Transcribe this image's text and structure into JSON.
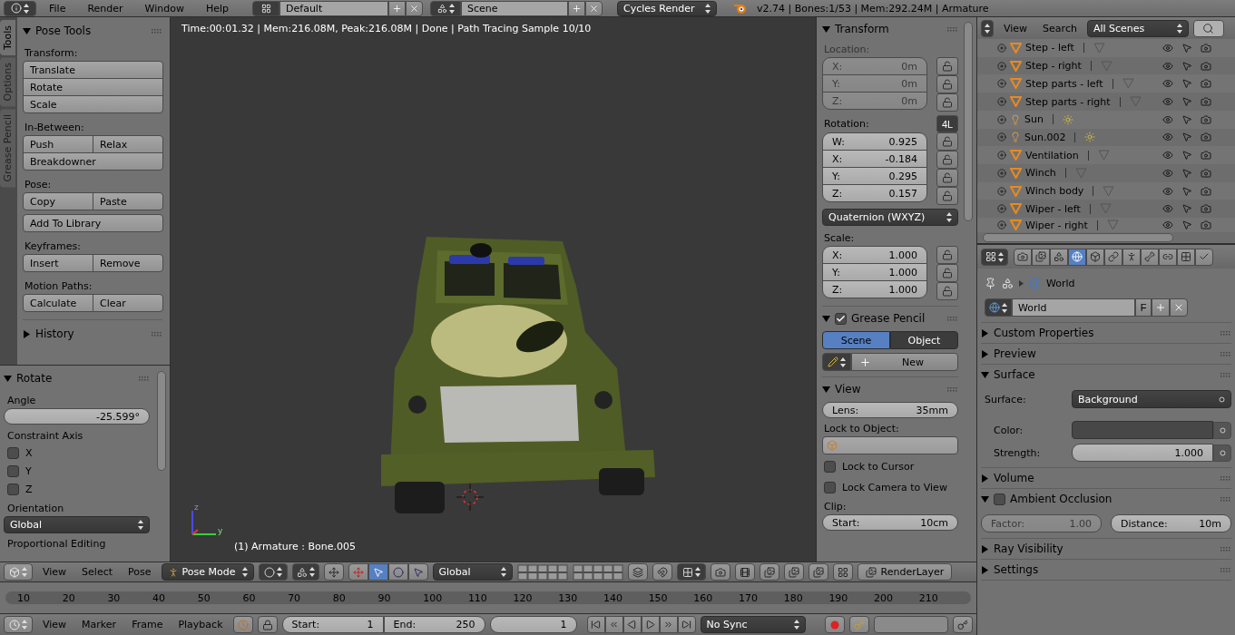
{
  "top_bar": {
    "menus": [
      "File",
      "Render",
      "Window",
      "Help"
    ],
    "screen_layout": "Default",
    "scene": "Scene",
    "render_engine": "Cycles Render",
    "stats": "v2.74 | Bones:1/53 | Mem:292.24M | Armature"
  },
  "tool_tabs": [
    {
      "label": "Tools",
      "selected": true
    },
    {
      "label": "Options",
      "selected": false
    },
    {
      "label": "Grease Pencil",
      "selected": false
    }
  ],
  "pose_tools": {
    "title": "Pose Tools",
    "expanded": true,
    "groups": [
      {
        "label": "Transform:",
        "blocks": [
          [
            [
              "Translate"
            ],
            [
              "Rotate"
            ],
            [
              "Scale"
            ]
          ]
        ]
      },
      {
        "label": "In-Between:",
        "blocks": [
          [
            [
              "Push",
              "Relax"
            ],
            [
              "Breakdowner"
            ]
          ]
        ]
      },
      {
        "label": "Pose:",
        "blocks": [
          [
            [
              "Copy",
              "Paste"
            ]
          ],
          [
            [
              "Add To Library"
            ]
          ]
        ]
      },
      {
        "label": "Keyframes:",
        "blocks": [
          [
            [
              "Insert",
              "Remove"
            ]
          ]
        ]
      },
      {
        "label": "Motion Paths:",
        "blocks": [
          [
            [
              "Calculate",
              "Clear"
            ]
          ]
        ]
      }
    ]
  },
  "history": {
    "title": "History",
    "expanded": false
  },
  "rotate_panel": {
    "title": "Rotate",
    "expanded": true,
    "angle_label": "Angle",
    "angle": "-25.599°",
    "constraint_label": "Constraint Axis",
    "axes": [
      {
        "label": "X",
        "checked": false
      },
      {
        "label": "Y",
        "checked": false
      },
      {
        "label": "Z",
        "checked": false
      }
    ],
    "orientation_label": "Orientation",
    "orientation": "Global",
    "proportional_label": "Proportional Editing"
  },
  "viewport": {
    "info": "Time:00:01.32 | Mem:216.08M, Peak:216.08M | Done | Path Tracing Sample 10/10",
    "axis_labels": [
      "z",
      "y"
    ],
    "object_label": "(1) Armature : Bone.005"
  },
  "n_panel": {
    "transform": {
      "title": "Transform",
      "expanded": true,
      "location_label": "Location:",
      "location_disabled": true,
      "location": [
        {
          "axis": "X:",
          "value": "0m",
          "locked": false
        },
        {
          "axis": "Y:",
          "value": "0m",
          "locked": false
        },
        {
          "axis": "Z:",
          "value": "0m",
          "locked": false
        }
      ],
      "rotation_label": "Rotation:",
      "rotation_lock_mode": "4L",
      "rotation": [
        {
          "axis": "W:",
          "value": "0.925",
          "locked": false
        },
        {
          "axis": "X:",
          "value": "-0.184",
          "locked": false
        },
        {
          "axis": "Y:",
          "value": "0.295",
          "locked": false
        },
        {
          "axis": "Z:",
          "value": "0.157",
          "locked": false
        }
      ],
      "rotation_mode": "Quaternion (WXYZ)",
      "scale_label": "Scale:",
      "scale": [
        {
          "axis": "X:",
          "value": "1.000",
          "locked": false
        },
        {
          "axis": "Y:",
          "value": "1.000",
          "locked": false
        },
        {
          "axis": "Z:",
          "value": "1.000",
          "locked": false
        }
      ]
    },
    "grease_pencil": {
      "title": "Grease Pencil",
      "expanded": true,
      "enabled": true,
      "sources": [
        {
          "label": "Scene",
          "selected": true
        },
        {
          "label": "Object",
          "selected": false
        }
      ],
      "new_button": "New"
    },
    "view": {
      "title": "View",
      "expanded": true,
      "lens_label": "Lens:",
      "lens": "35mm",
      "lock_object_label": "Lock to Object:",
      "options": [
        {
          "label": "Lock to Cursor",
          "checked": false
        },
        {
          "label": "Lock Camera to View",
          "checked": false
        }
      ],
      "clip_label": "Clip:",
      "clip_start_label": "Start:",
      "clip_start": "10cm"
    }
  },
  "viewport_header": {
    "menus": [
      "View",
      "Select",
      "Pose"
    ],
    "mode": "Pose Mode",
    "orientation": "Global",
    "render_layer": "RenderLayer"
  },
  "timeline": {
    "ticks": [
      "10",
      "20",
      "30",
      "40",
      "50",
      "60",
      "70",
      "80",
      "90",
      "100",
      "110",
      "120",
      "130",
      "140",
      "150",
      "160",
      "170",
      "180",
      "190",
      "200",
      "210"
    ]
  },
  "timeline_header": {
    "menus": [
      "View",
      "Marker",
      "Frame",
      "Playback"
    ],
    "start_label": "Start:",
    "start": "1",
    "end_label": "End:",
    "end": "250",
    "current_frame": "1",
    "sync": "No Sync"
  },
  "outliner": {
    "menus": [
      "View",
      "Search"
    ],
    "filter": "All Scenes",
    "items": [
      {
        "name": "Step - left",
        "kind": "mesh"
      },
      {
        "name": "Step - right",
        "kind": "mesh"
      },
      {
        "name": "Step parts - left",
        "kind": "mesh"
      },
      {
        "name": "Step parts - right",
        "kind": "mesh"
      },
      {
        "name": "Sun",
        "kind": "lamp"
      },
      {
        "name": "Sun.002",
        "kind": "lamp"
      },
      {
        "name": "Ventilation",
        "kind": "mesh"
      },
      {
        "name": "Winch",
        "kind": "mesh"
      },
      {
        "name": "Winch body",
        "kind": "mesh"
      },
      {
        "name": "Wiper - left",
        "kind": "mesh"
      },
      {
        "name": "Wiper - right",
        "kind": "mesh"
      }
    ]
  },
  "properties": {
    "tabs": [
      {
        "kind": "render",
        "selected": false
      },
      {
        "kind": "layers",
        "selected": false
      },
      {
        "kind": "scene",
        "selected": false
      },
      {
        "kind": "world",
        "selected": true
      },
      {
        "kind": "object",
        "selected": false
      },
      {
        "kind": "constraints",
        "selected": false
      },
      {
        "kind": "armature",
        "selected": false
      },
      {
        "kind": "bone",
        "selected": false
      },
      {
        "kind": "bone_constraints",
        "selected": false
      },
      {
        "kind": "texture",
        "selected": false
      },
      {
        "kind": "physics",
        "selected": false
      }
    ],
    "breadcrumb": "World",
    "datablock": "World",
    "fake_user": "F",
    "panels": [
      {
        "kind": "plain",
        "title": "Custom Properties",
        "expanded": false
      },
      {
        "kind": "plain",
        "title": "Preview",
        "expanded": false
      },
      {
        "kind": "surface",
        "title": "Surface",
        "expanded": true,
        "surface_label": "Surface:",
        "surface": "Background",
        "color_label": "Color:",
        "strength_label": "Strength:",
        "strength": "1.000"
      },
      {
        "kind": "plain",
        "title": "Volume",
        "expanded": false
      },
      {
        "kind": "ao",
        "title": "Ambient Occlusion",
        "expanded": true,
        "enabled": false,
        "factor_label": "Factor:",
        "factor": "1.00",
        "distance_label": "Distance:",
        "distance": "10m"
      },
      {
        "kind": "plain",
        "title": "Ray Visibility",
        "expanded": false
      },
      {
        "kind": "plain",
        "title": "Settings",
        "expanded": false
      }
    ]
  }
}
